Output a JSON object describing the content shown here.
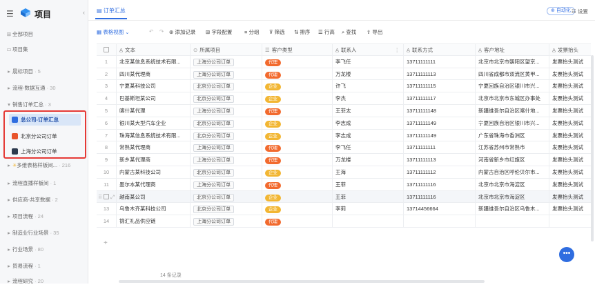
{
  "sidebar": {
    "title": "项目",
    "menu_icon": "hamburger-icon",
    "items": [
      {
        "label": "全部项目",
        "icon": "grid-icon",
        "count": ""
      },
      {
        "label": "项目集",
        "icon": "folder-icon",
        "count": ""
      },
      {
        "label": "晨标项目",
        "icon": "triangle-right-icon",
        "count": "· 5"
      },
      {
        "label": "流程-数据互通",
        "icon": "triangle-right-icon",
        "count": "· 30"
      },
      {
        "label": "销售订单汇总",
        "icon": "triangle-down-icon",
        "count": "· 3"
      },
      {
        "label": "多维表格样板间...",
        "icon": "triangle-right-icon",
        "count": "· 216"
      },
      {
        "label": "流程直播样板间",
        "icon": "triangle-right-icon",
        "count": "· 1"
      },
      {
        "label": "供应商-共享数据",
        "icon": "triangle-right-icon",
        "count": "· 2"
      },
      {
        "label": "项目流程",
        "icon": "triangle-right-icon",
        "count": "· 24"
      },
      {
        "label": "制造业行业场景",
        "icon": "triangle-right-icon",
        "count": "· 35"
      },
      {
        "label": "行业场景",
        "icon": "triangle-right-icon",
        "count": "· 80"
      },
      {
        "label": "贸易流程",
        "icon": "triangle-right-icon",
        "count": "· 1"
      },
      {
        "label": "流程研究",
        "icon": "triangle-right-icon",
        "count": "· 20"
      }
    ],
    "sub_items": [
      {
        "label": "总公司-订单汇总",
        "color": "#2f6de0",
        "active": true
      },
      {
        "label": "北京分公司订单",
        "color": "#e8542c",
        "active": false
      },
      {
        "label": "上海分公司订单",
        "color": "#2e3b4e",
        "active": false
      }
    ]
  },
  "topbar": {
    "tab_label": "订单汇总",
    "automation_label": "自动化",
    "settings_label": "设置"
  },
  "toolbar": {
    "view_label": "表格视图",
    "add_record": "添加记录",
    "field_config": "字段配置",
    "group": "分组",
    "filter": "筛选",
    "sort": "排序",
    "row_height": "行高",
    "search": "查找",
    "export": "导出"
  },
  "table": {
    "columns": [
      "文本",
      "所属项目",
      "客户类型",
      "联系人",
      "联系方式",
      "客户地址",
      "发票抬头"
    ],
    "rows": [
      {
        "n": "1",
        "name": "北京某信息系统技术有限...",
        "project": "上海分公司订单",
        "type": "代理",
        "contact": "李飞任",
        "phone": "13711111111",
        "address": "北京市北京市朝阳区望京...",
        "invoice": "发票抬头测试"
      },
      {
        "n": "2",
        "name": "四川某代理商",
        "project": "上海分公司订单",
        "type": "代理",
        "contact": "万龙楼",
        "phone": "13711111113",
        "address": "四川省成都市双流区黄甲...",
        "invoice": "发票抬头测试"
      },
      {
        "n": "3",
        "name": "宁夏某科技公司",
        "project": "北京分公司订单",
        "type": "企业",
        "contact": "许飞",
        "phone": "13711111115",
        "address": "宁夏回族自治区银川市兴...",
        "invoice": "发票抬头测试"
      },
      {
        "n": "4",
        "name": "巴基斯坦某公司",
        "project": "北京分公司订单",
        "type": "企业",
        "contact": "李杰",
        "phone": "13711111117",
        "address": "北京市北京市东城区办事处",
        "invoice": "发票抬头测试"
      },
      {
        "n": "5",
        "name": "喀什某代理",
        "project": "上海分公司订单",
        "type": "代理",
        "contact": "王菲太",
        "phone": "13711111148",
        "address": "新疆维吾尔自治区喀什地...",
        "invoice": "发票抬头测试"
      },
      {
        "n": "6",
        "name": "银川某大型汽车企业",
        "project": "北京分公司订单",
        "type": "企业",
        "contact": "李志成",
        "phone": "13711111149",
        "address": "宁夏回族自治区银川市兴...",
        "invoice": "发票抬头测试"
      },
      {
        "n": "7",
        "name": "珠海某信息系统技术有限...",
        "project": "北京分公司订单",
        "type": "企业",
        "contact": "李志成",
        "phone": "13711111149",
        "address": "广东省珠海市香洲区",
        "invoice": "发票抬头测试"
      },
      {
        "n": "8",
        "name": "常熟某代理商",
        "project": "上海分公司订单",
        "type": "代理",
        "contact": "李飞任",
        "phone": "13711111111",
        "address": "江苏省苏州市常熟市",
        "invoice": "发票抬头测试"
      },
      {
        "n": "9",
        "name": "新乡某代理商",
        "project": "上海分公司订单",
        "type": "代理",
        "contact": "万龙楼",
        "phone": "13711111113",
        "address": "河南省新乡市红旗区",
        "invoice": "发票抬头测试"
      },
      {
        "n": "10",
        "name": "内蒙古某科技公司",
        "project": "北京分公司订单",
        "type": "企业",
        "contact": "王海",
        "phone": "13711111112",
        "address": "内蒙古自治区呼伦贝尔市...",
        "invoice": "发票抬头测试"
      },
      {
        "n": "11",
        "name": "墨尔本某代理商",
        "project": "上海分公司订单",
        "type": "代理",
        "contact": "王菲",
        "phone": "13711111116",
        "address": "北京市北京市海淀区",
        "invoice": "发票抬头测试"
      },
      {
        "n": "12",
        "name": "越南某公司",
        "project": "北京分公司订单",
        "type": "企业",
        "contact": "王菲",
        "phone": "13711111116",
        "address": "北京市北京市海淀区",
        "invoice": "发票抬头测试"
      },
      {
        "n": "13",
        "name": "乌鲁木齐某科技公司",
        "project": "北京分公司订单",
        "type": "企业",
        "contact": "李莉",
        "phone": "13714456664",
        "address": "新疆维吾尔自治区乌鲁木...",
        "invoice": "发票抬头测试"
      },
      {
        "n": "14",
        "name": "锦汇礼品供应链",
        "project": "上海分公司订单",
        "type": "代理",
        "contact": "",
        "phone": "",
        "address": "",
        "invoice": ""
      }
    ]
  },
  "footer": {
    "record_count": "14 条记录"
  },
  "colors": {
    "accent": "#2f6de0",
    "agent_pill": "#f26a2e",
    "enterprise_pill": "#f2b632"
  }
}
